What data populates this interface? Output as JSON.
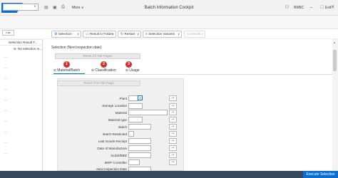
{
  "titlebar": {
    "logo": "SAP",
    "title": "Batch Information Cockpit",
    "system_id": "RM5C"
  },
  "toolbar": {
    "more_label": "More",
    "more_chevron": "∨",
    "exit_label": "Exit",
    "command_dropdown": "∨"
  },
  "app_toolbar": {
    "items": [
      {
        "label": "Selection"
      },
      {
        "label": "Result in Folder"
      },
      {
        "label": "Restart"
      },
      {
        "label": "Selection Variants"
      },
      {
        "label": "Details"
      }
    ]
  },
  "left_panel": {
    "list_button": "List",
    "column_header": "Selection Result T...",
    "item_text": "No selection m..."
  },
  "main": {
    "section_title": "Selection (Next inspection date)",
    "reset_all_button": "Reset All Tab Pages",
    "reset_tab_button": "Reset This Tab Page",
    "tabs": [
      {
        "label": "Material/Batch",
        "badge": "1"
      },
      {
        "label": "Classification",
        "badge": "2"
      },
      {
        "label": "Usage",
        "badge": "3"
      }
    ],
    "fields": [
      {
        "label": "Plant"
      },
      {
        "label": "Storage Location"
      },
      {
        "label": "Material"
      },
      {
        "label": "Material type"
      },
      {
        "label": "Batch"
      },
      {
        "label": "Batch Restricted"
      },
      {
        "label": "Last Goods Receipt"
      },
      {
        "label": "Date of Manufacture"
      },
      {
        "label": "SLED/BBD"
      },
      {
        "label": "MRP Controller"
      },
      {
        "label": "Next Inspection Date"
      }
    ]
  },
  "footer": {
    "execute_button": "Execute Selection"
  },
  "colors": {
    "accent": "#0a6ed1",
    "badge": "#d32f2f",
    "footer": "#354a5f"
  }
}
